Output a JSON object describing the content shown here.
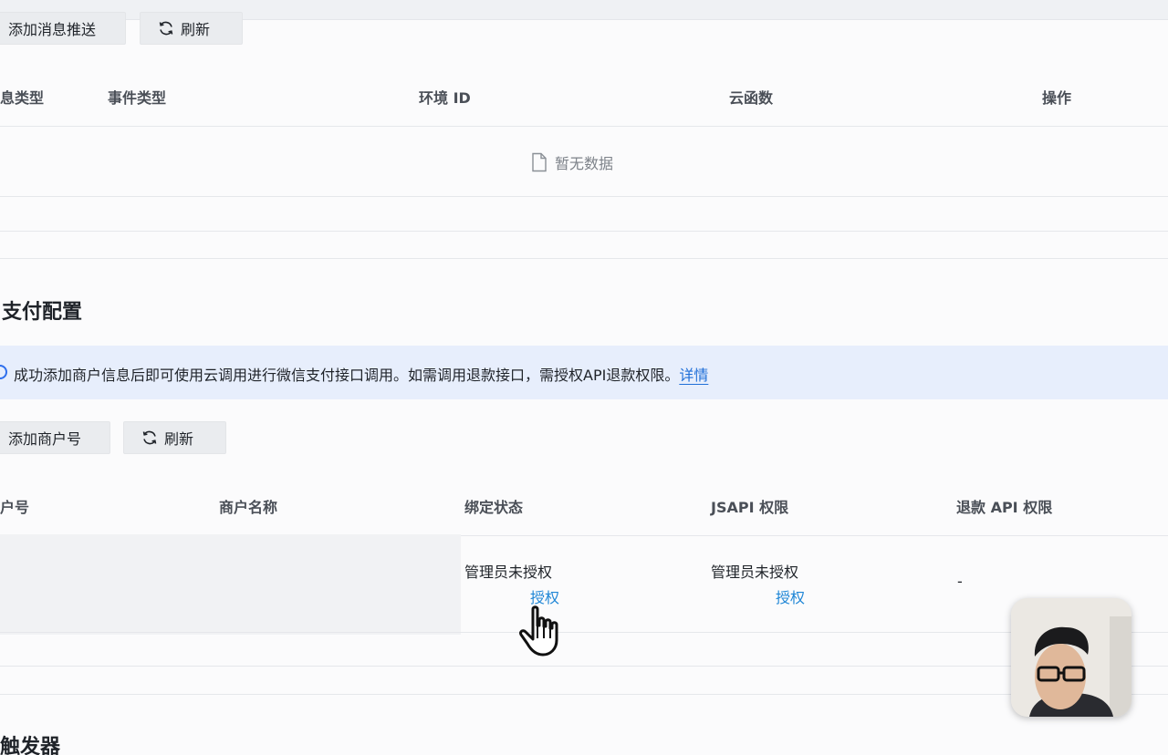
{
  "message_push": {
    "add_button": "添加消息推送",
    "refresh_button": "刷新",
    "columns": [
      "息类型",
      "事件类型",
      "环境 ID",
      "云函数",
      "操作"
    ],
    "empty_text": "暂无数据"
  },
  "payment": {
    "title": "支付配置",
    "notice_text": "成功添加商户信息后即可使用云调用进行微信支付接口调用。如需调用退款接口，需授权API退款权限。",
    "notice_link": "详情",
    "add_button": "添加商户号",
    "refresh_button": "刷新",
    "columns": [
      "户号",
      "商户名称",
      "绑定状态",
      "JSAPI 权限",
      "退款 API 权限"
    ],
    "row": {
      "bind_status": "管理员未授权",
      "bind_action": "授权",
      "jsapi_status": "管理员未授权",
      "jsapi_action": "授权",
      "refund": "-"
    }
  },
  "trigger": {
    "title": "触发器"
  },
  "colors": {
    "link": "#1f86d6",
    "notice_bg": "#e7eefc",
    "button_bg": "#eaecef"
  }
}
